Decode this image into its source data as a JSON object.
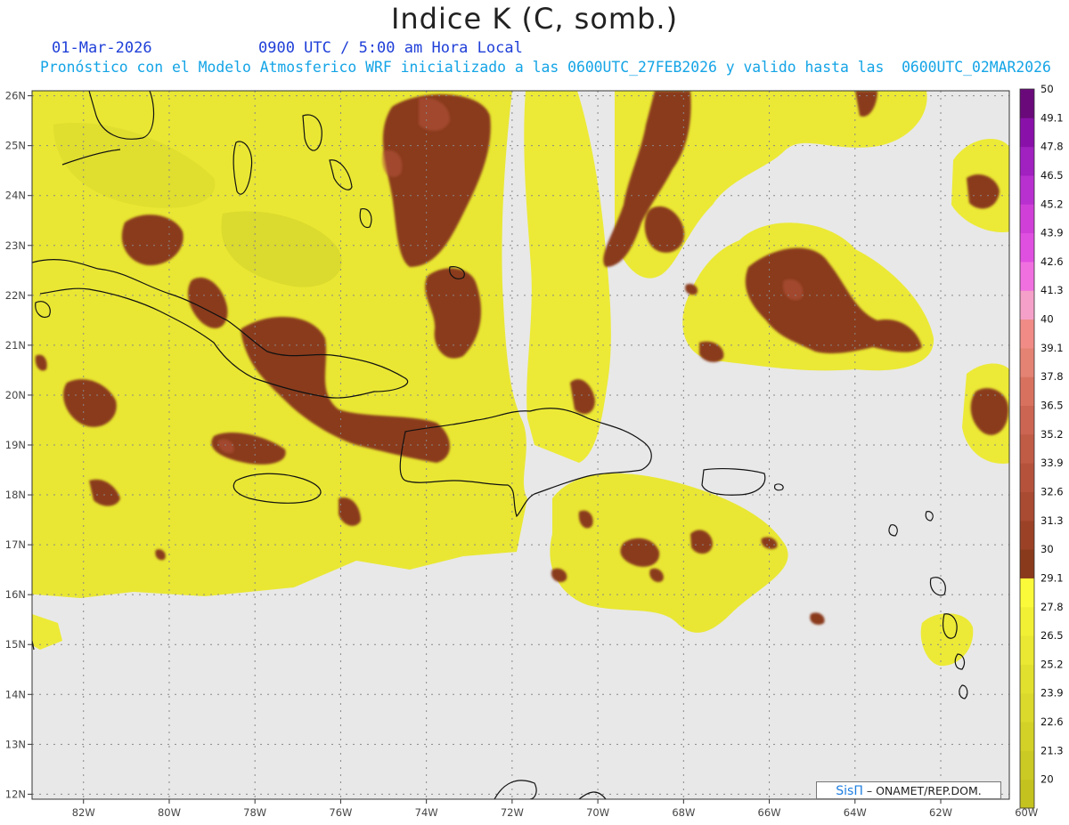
{
  "header": {
    "title": "Indice K (C, somb.)",
    "date": "01-Mar-2026",
    "time": "0900 UTC / 5:00 am Hora Local",
    "info": "Pronóstico con el Modelo Atmosferico WRF inicializado a las 0600UTC_27FEB2026 y valido hasta las  0600UTC_02MAR2026"
  },
  "map": {
    "lon_range": [
      -83.2,
      -60.4
    ],
    "lat_range": [
      11.9,
      26.1
    ],
    "lon_ticks": [
      "82W",
      "80W",
      "78W",
      "76W",
      "74W",
      "72W",
      "70W",
      "68W",
      "66W",
      "64W",
      "62W",
      "60W"
    ],
    "lat_ticks": [
      "12N",
      "13N",
      "14N",
      "15N",
      "16N",
      "17N",
      "18N",
      "19N",
      "20N",
      "21N",
      "22N",
      "23N",
      "24N",
      "25N",
      "26N"
    ],
    "colors": {
      "background": "#e8e8e8",
      "coast": "#111111",
      "grid": "#888888"
    }
  },
  "colorbar": {
    "labels": [
      "20",
      "21.3",
      "22.6",
      "23.9",
      "25.2",
      "26.5",
      "27.8",
      "29.1",
      "30",
      "31.3",
      "32.6",
      "33.9",
      "35.2",
      "36.5",
      "37.8",
      "39.1",
      "40",
      "41.3",
      "42.6",
      "43.9",
      "45.2",
      "46.5",
      "47.8",
      "49.1",
      "50"
    ],
    "colors": [
      "#c4c21e",
      "#cbc923",
      "#d3d127",
      "#dbd92b",
      "#e2e02e",
      "#eae832",
      "#f2f035",
      "#fafa3b",
      "#8a3a1c",
      "#9b4226",
      "#a94a32",
      "#b5523c",
      "#c05b46",
      "#cc6552",
      "#d8725f",
      "#e48374",
      "#f08b86",
      "#f5a0c8",
      "#f070e0",
      "#e050e0",
      "#d040d8",
      "#b830d0",
      "#a020c0",
      "#8a10aa",
      "#6a0a7a"
    ]
  },
  "credit": {
    "logo": "SisΠ",
    "text": "– ONAMET/REP.DOM."
  }
}
